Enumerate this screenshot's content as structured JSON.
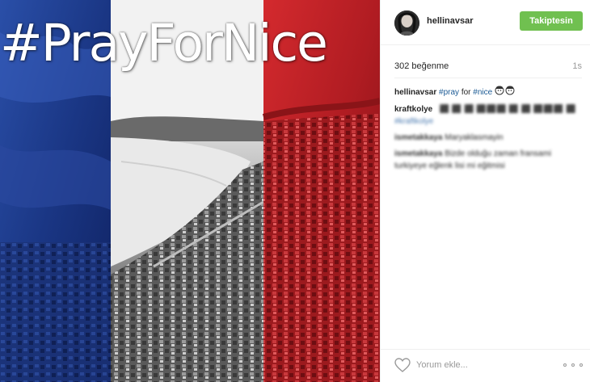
{
  "post": {
    "image_caption_overlay": "#PrayForNice",
    "flag_colors": {
      "blue": "#1f3f8f",
      "white": "#ffffff",
      "red": "#c4191f"
    }
  },
  "header": {
    "username": "hellinavsar",
    "follow_label": "Takiptesin",
    "follow_color": "#70c050"
  },
  "stats": {
    "likes": "302 beğenme",
    "time": "1s"
  },
  "caption": {
    "user": "hellinavsar",
    "tag1": "#pray",
    "word": "for",
    "tag2": "#nice"
  },
  "comments": [
    {
      "user": "kraftkolye",
      "text": "  ⬛ ⬛ ⬛ ⬛⬛⬛ ⬛ ⬛ ⬛⬛⬛ ⬛ ",
      "tag": "#kraftkolye"
    },
    {
      "user": "ismetakkaya",
      "text": "Maryaklasmayin",
      "tag": ""
    },
    {
      "user": "ismetakkaya",
      "text": "Bizde olduğu zaman fransami turkiyeye eğlenk lisi mi eğitmisi",
      "tag": ""
    }
  ],
  "footer": {
    "comment_placeholder": "Yorum ekle...",
    "heart_icon": "heart-outline-icon",
    "more_icon": "more-options-icon"
  }
}
